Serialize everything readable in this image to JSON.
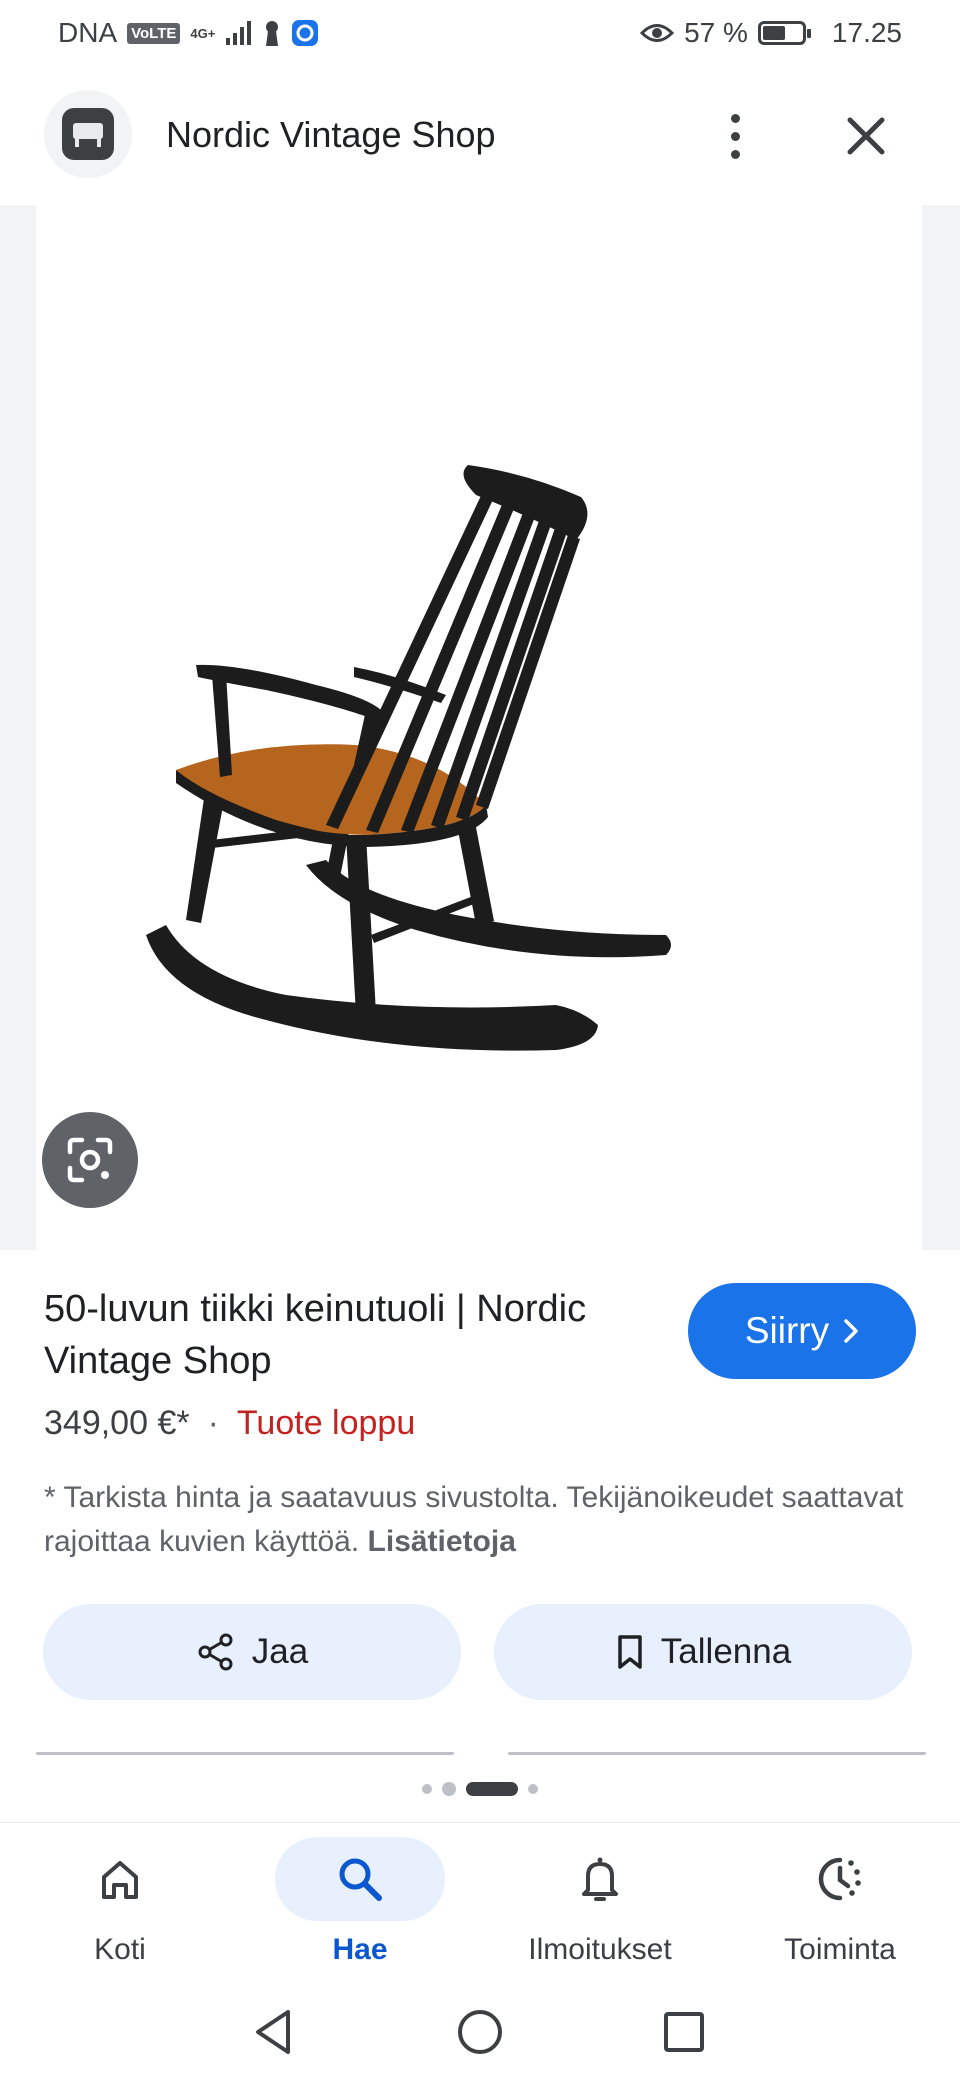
{
  "status_bar": {
    "carrier": "DNA",
    "volte": "VoLTE",
    "network": "4G+",
    "battery": "57 %",
    "battery_level": 0.57,
    "time": "17.25"
  },
  "header": {
    "site_name": "Nordic Vintage Shop",
    "icons": [
      "store-favicon-icon",
      "more-vert-icon",
      "close-icon"
    ]
  },
  "product": {
    "title": "50-luvun tiikki keinutuoli | Nordic Vintage Shop",
    "go_button": "Siirry",
    "price": "349,00 €*",
    "separator": "·",
    "stock_status": "Tuote loppu",
    "disclaimer": "* Tarkista hinta ja saatavuus sivustolta. Tekijänoikeudet saattavat rajoittaa kuvien käyttöä.",
    "more_info_link": "Lisätietoja"
  },
  "actions": {
    "share": "Jaa",
    "save": "Tallenna"
  },
  "bottom_nav": {
    "items": [
      {
        "label": "Koti",
        "icon": "home-icon",
        "active": false
      },
      {
        "label": "Hae",
        "icon": "search-icon",
        "active": true
      },
      {
        "label": "Ilmoitukset",
        "icon": "bell-icon",
        "active": false
      },
      {
        "label": "Toiminta",
        "icon": "activity-icon",
        "active": false
      }
    ]
  },
  "colors": {
    "accent": "#1a73e8",
    "out_of_stock": "#c5221f",
    "chip_background": "#e8f0fe"
  }
}
